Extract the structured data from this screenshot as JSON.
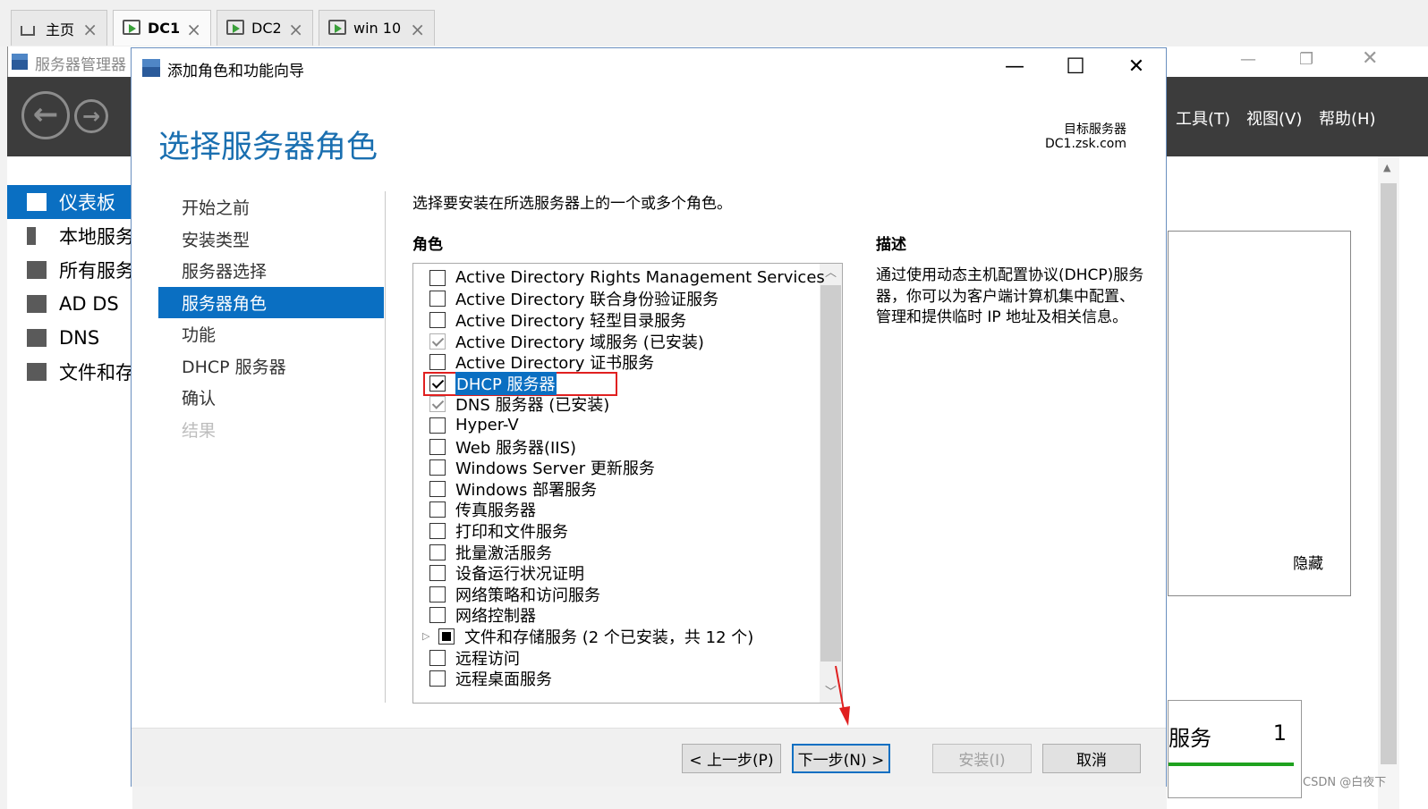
{
  "vm_tabs": [
    {
      "label": "主页",
      "icon": "home-icon"
    },
    {
      "label": "DC1",
      "icon": "vm-icon"
    },
    {
      "label": "DC2",
      "icon": "vm-icon"
    },
    {
      "label": "win 10",
      "icon": "vm-icon"
    }
  ],
  "server_manager": {
    "title": "服务器管理器",
    "menu": [
      "工具(T)",
      "视图(V)",
      "帮助(H)"
    ],
    "sidebar": [
      {
        "label": "仪表板",
        "selected": true
      },
      {
        "label": "本地服务器"
      },
      {
        "label": "所有服务器"
      },
      {
        "label": "AD DS"
      },
      {
        "label": "DNS"
      },
      {
        "label": "文件和存储服务"
      }
    ],
    "hide_label": "隐藏",
    "tile": {
      "title": "服务",
      "count": "1"
    }
  },
  "dialog": {
    "title": "添加角色和功能向导",
    "heading": "选择服务器角色",
    "target_label": "目标服务器",
    "target_value": "DC1.zsk.com",
    "steps": [
      {
        "label": "开始之前",
        "state": "normal"
      },
      {
        "label": "安装类型",
        "state": "normal"
      },
      {
        "label": "服务器选择",
        "state": "normal"
      },
      {
        "label": "服务器角色",
        "state": "selected"
      },
      {
        "label": "功能",
        "state": "normal"
      },
      {
        "label": "DHCP 服务器",
        "state": "normal"
      },
      {
        "label": "确认",
        "state": "normal"
      },
      {
        "label": "结果",
        "state": "disabled"
      }
    ],
    "instruction": "选择要安装在所选服务器上的一个或多个角色。",
    "roles_header": "角色",
    "description_header": "描述",
    "description": "通过使用动态主机配置协议(DHCP)服务器，你可以为客户端计算机集中配置、管理和提供临时 IP 地址及相关信息。",
    "roles": [
      {
        "label": "Active Directory Rights Management Services",
        "state": "unchecked"
      },
      {
        "label": "Active Directory 联合身份验证服务",
        "state": "unchecked"
      },
      {
        "label": "Active Directory 轻型目录服务",
        "state": "unchecked"
      },
      {
        "label": "Active Directory 域服务 (已安装)",
        "state": "installed"
      },
      {
        "label": "Active Directory 证书服务",
        "state": "unchecked"
      },
      {
        "label": "DHCP 服务器",
        "state": "checked",
        "highlighted": true
      },
      {
        "label": "DNS 服务器 (已安装)",
        "state": "installed"
      },
      {
        "label": "Hyper-V",
        "state": "unchecked"
      },
      {
        "label": "Web 服务器(IIS)",
        "state": "unchecked"
      },
      {
        "label": "Windows Server 更新服务",
        "state": "unchecked"
      },
      {
        "label": "Windows 部署服务",
        "state": "unchecked"
      },
      {
        "label": "传真服务器",
        "state": "unchecked"
      },
      {
        "label": "打印和文件服务",
        "state": "unchecked"
      },
      {
        "label": "批量激活服务",
        "state": "unchecked"
      },
      {
        "label": "设备运行状况证明",
        "state": "unchecked"
      },
      {
        "label": "网络策略和访问服务",
        "state": "unchecked"
      },
      {
        "label": "网络控制器",
        "state": "unchecked"
      },
      {
        "label": "文件和存储服务 (2 个已安装，共 12 个)",
        "state": "partial",
        "expandable": true
      },
      {
        "label": "远程访问",
        "state": "unchecked"
      },
      {
        "label": "远程桌面服务",
        "state": "unchecked"
      }
    ],
    "buttons": {
      "prev": "< 上一步(P)",
      "next": "下一步(N) >",
      "install": "安装(I)",
      "cancel": "取消"
    }
  },
  "watermark": "CSDN @白夜下",
  "colors": {
    "accent": "#0a6fc2",
    "annotation": "#e02020",
    "header_dark": "#3c3c3c"
  }
}
